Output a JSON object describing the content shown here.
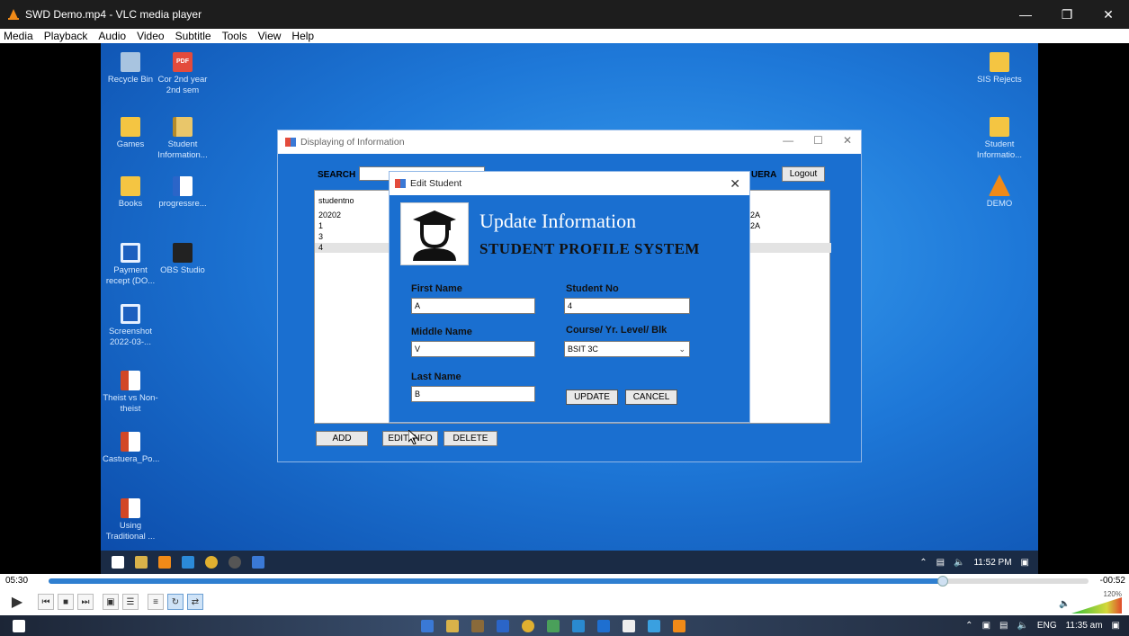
{
  "vlc": {
    "title": "SWD Demo.mp4 - VLC media player",
    "menu": [
      "Media",
      "Playback",
      "Audio",
      "Video",
      "Subtitle",
      "Tools",
      "View",
      "Help"
    ],
    "time_elapsed": "05:30",
    "time_remaining": "-00:52",
    "progress": 0.86,
    "volume_label": "120%"
  },
  "desktop": {
    "icons": [
      {
        "label": "Recycle Bin"
      },
      {
        "label": "Cor 2nd year 2nd sem"
      },
      {
        "label": "Games"
      },
      {
        "label": "Student Information..."
      },
      {
        "label": "Books"
      },
      {
        "label": "progressre..."
      },
      {
        "label": "Payment recept (DO..."
      },
      {
        "label": "OBS Studio"
      },
      {
        "label": "Screenshot 2022-03-..."
      },
      {
        "label": "Theist vs Non-theist"
      },
      {
        "label": "Castuera_Po..."
      },
      {
        "label": "Using Traditional ..."
      },
      {
        "label": "SIS Rejects"
      },
      {
        "label": "Student Informatio..."
      },
      {
        "label": "DEMO"
      }
    ],
    "pdf_glyph": "PDF",
    "tray_time": "11:52 PM"
  },
  "info_window": {
    "title": "Displaying of Information",
    "search_label": "SEARCH",
    "uera_label": "UERA",
    "logout_label": "Logout",
    "grid_header": "studentno",
    "grid_rows": [
      "20202",
      "1",
      "3",
      "4"
    ],
    "grid_col2": [
      "2A",
      "2A"
    ],
    "add_label": "ADD",
    "edit_label": "EDIT INFO",
    "delete_label": "DELETE"
  },
  "edit_dialog": {
    "title": "Edit Student",
    "heading": "Update Information",
    "subheading": "STUDENT PROFILE SYSTEM",
    "first_name_label": "First Name",
    "first_name_value": "A",
    "middle_name_label": "Middle Name",
    "middle_name_value": "V",
    "last_name_label": "Last Name",
    "last_name_value": "B",
    "student_no_label": "Student No",
    "student_no_value": "4",
    "course_label": "Course/ Yr. Level/ Blk",
    "course_value": "BSIT 3C",
    "update_label": "UPDATE",
    "cancel_label": "CANCEL"
  },
  "host": {
    "tray_lang": "ENG",
    "tray_time": "11:35 am"
  }
}
